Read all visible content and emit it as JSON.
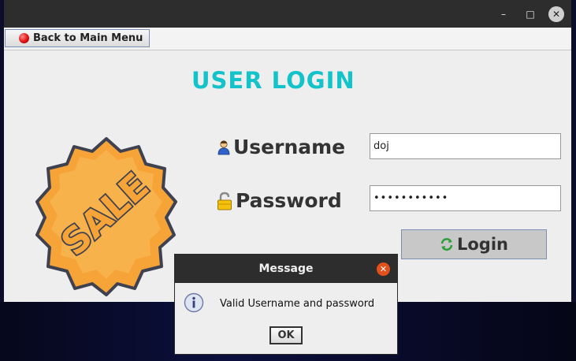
{
  "window": {
    "controls": {
      "minimize": "–",
      "maximize": "□",
      "close": "✕"
    }
  },
  "toolbar": {
    "back_label": "Back to Main Menu"
  },
  "login": {
    "title": "USER LOGIN",
    "username_label": "Username",
    "password_label": "Password",
    "username_value": "doj",
    "password_value": "•••••••••••",
    "login_label": "Login"
  },
  "badge": {
    "text": "SALE"
  },
  "dialog": {
    "title": "Message",
    "message": "Valid Username and password",
    "ok_label": "OK",
    "close_glyph": "✕"
  },
  "colors": {
    "title": "#13c3c9",
    "badge_orange": "#f6a437",
    "badge_outline": "#3e4150",
    "titlebar": "#2d2d2d",
    "dialog_close": "#e2511c"
  },
  "icons": [
    "red-dot-icon",
    "user-icon",
    "lock-icon",
    "refresh-icon",
    "info-icon",
    "sale-badge-icon"
  ]
}
